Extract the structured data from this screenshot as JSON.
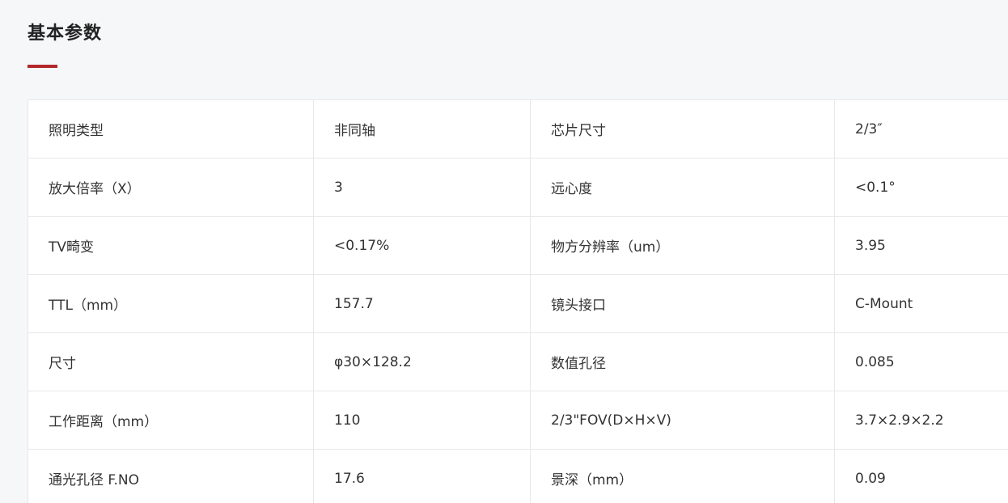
{
  "section": {
    "title": "基本参数",
    "accent_color": "#b3282d"
  },
  "rows": [
    {
      "label1": "照明类型",
      "value1": "非同轴",
      "label2": "芯片尺寸",
      "value2": "2/3″"
    },
    {
      "label1": "放大倍率（X）",
      "value1": "3",
      "label2": "远心度",
      "value2": "<0.1°"
    },
    {
      "label1": "TV畸变",
      "value1": "<0.17%",
      "label2": "物方分辨率（um）",
      "value2": "3.95"
    },
    {
      "label1": "TTL（mm）",
      "value1": "157.7",
      "label2": "镜头接口",
      "value2": "C-Mount"
    },
    {
      "label1": "尺寸",
      "value1": "φ30×128.2",
      "label2": "数值孔径",
      "value2": "0.085"
    },
    {
      "label1": "工作距离（mm）",
      "value1": "110",
      "label2": "2/3\"FOV(D×H×V)",
      "value2": "3.7×2.9×2.2"
    },
    {
      "label1": "通光孔径 F.NO",
      "value1": "17.6",
      "label2": "景深（mm）",
      "value2": "0.09"
    }
  ]
}
